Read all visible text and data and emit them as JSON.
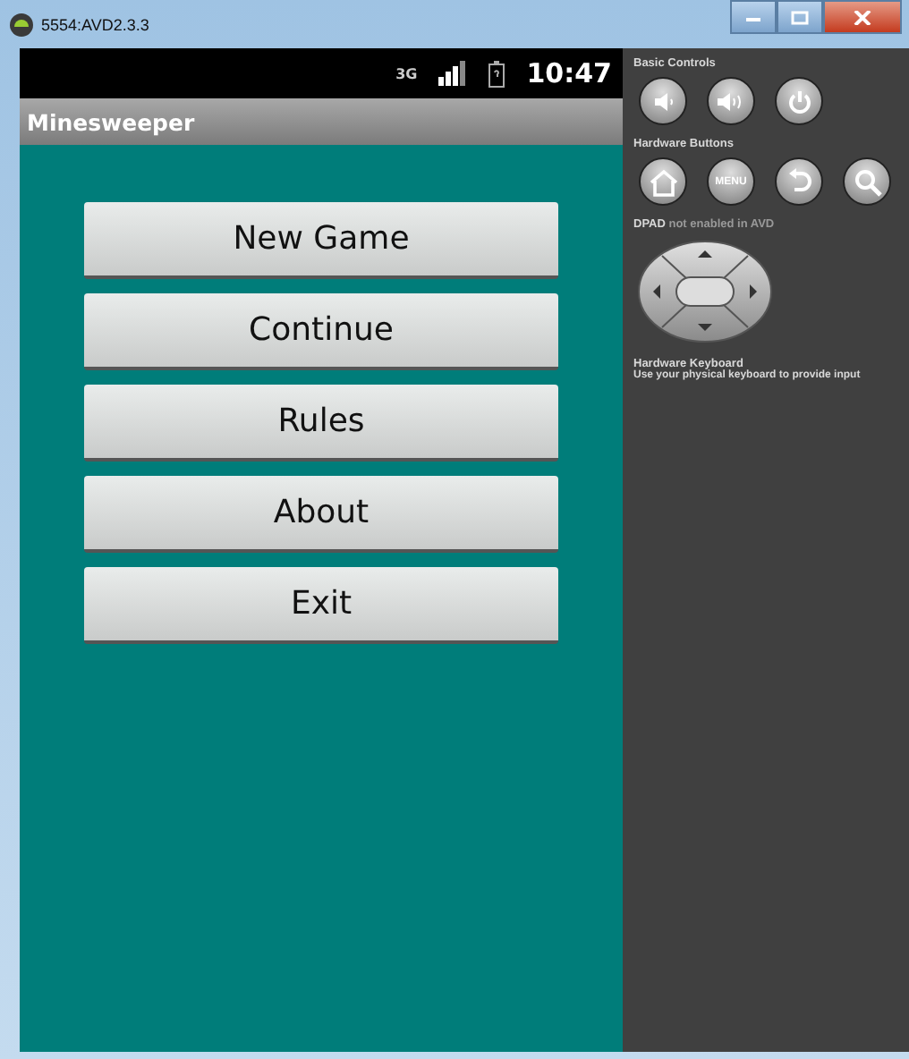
{
  "window": {
    "title": "5554:AVD2.3.3"
  },
  "status_bar": {
    "network": "3G",
    "time": "10:47"
  },
  "app": {
    "title": "Minesweeper",
    "buttons": [
      "New Game",
      "Continue",
      "Rules",
      "About",
      "Exit"
    ]
  },
  "controls": {
    "basic_label": "Basic Controls",
    "hardware_label": "Hardware Buttons",
    "menu_key": "MENU",
    "dpad_note": "**DPAD** not enabled in AVD",
    "keyboard_title": "Hardware Keyboard",
    "keyboard_note": "Use your physical keyboard to provide input"
  }
}
